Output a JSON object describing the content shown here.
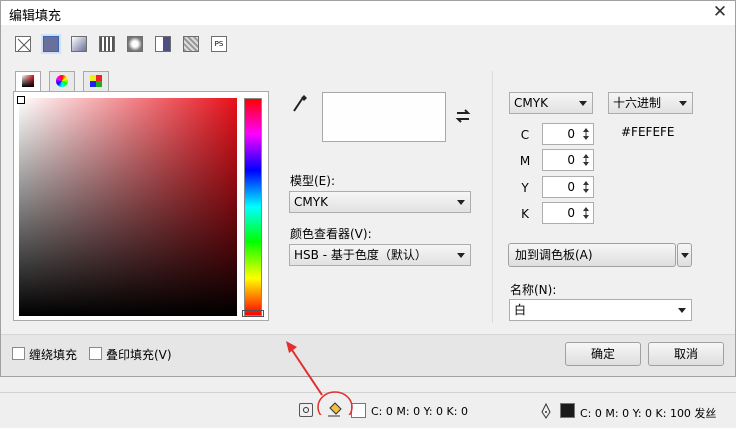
{
  "dialog": {
    "title": "编辑填充",
    "close_icon": "close-icon"
  },
  "fill_types": [
    "no-fill-icon",
    "uniform-fill-icon",
    "fountain-fill-icon",
    "vector-pattern-fill-icon",
    "bitmap-pattern-fill-icon",
    "two-color-pattern-fill-icon",
    "texture-fill-icon",
    "postscript-fill-icon"
  ],
  "tabs": [
    "color-viewer-tab",
    "color-wheel-tab",
    "palette-tab"
  ],
  "model": {
    "label": "模型(E):",
    "value": "CMYK"
  },
  "viewer": {
    "label": "颜色查看器(V):",
    "value": "HSB - 基于色度（默认）"
  },
  "right": {
    "model_combo": "CMYK",
    "hex_combo": "十六进制",
    "hex_value": "#FEFEFE",
    "channels": [
      {
        "name": "C",
        "value": "0"
      },
      {
        "name": "M",
        "value": "0"
      },
      {
        "name": "Y",
        "value": "0"
      },
      {
        "name": "K",
        "value": "0"
      }
    ],
    "add_palette": "加到调色板(A)",
    "name_label": "名称(N):",
    "name_value": "白"
  },
  "options": {
    "wrap_fill": "缠绕填充",
    "overprint_fill": "叠印填充(V)"
  },
  "buttons": {
    "ok": "确定",
    "cancel": "取消"
  },
  "statusbar": {
    "fill_text": "C: 0 M: 0 Y: 0 K: 0",
    "outline_text": "C: 0 M: 0 Y: 0 K: 100  发丝"
  },
  "colors": {
    "preview": "#FEFEFE",
    "hue": "#e8101a",
    "annotation": "#e03030",
    "outline_swatch": "#1a1a1a"
  }
}
